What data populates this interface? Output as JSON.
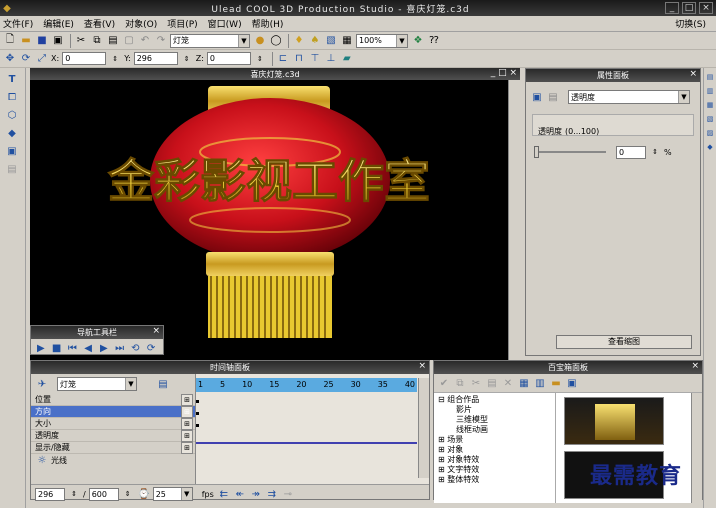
{
  "app": {
    "title": "Ulead COOL 3D Production Studio - 喜庆灯笼.c3d"
  },
  "menu": [
    "文件(F)",
    "编辑(E)",
    "查看(V)",
    "对象(O)",
    "项目(P)",
    "窗口(W)",
    "帮助(H)"
  ],
  "menu_right": "切换(S)",
  "toolbar": {
    "object_combo": "灯笼",
    "zoom_combo": "100%",
    "x_label": "X:",
    "x_value": "0",
    "y_label": "Y:",
    "y_value": "296",
    "z_label": "Z:",
    "z_value": "0"
  },
  "document": {
    "title": "喜庆灯笼.c3d",
    "banner_text": "金彩影视工作室"
  },
  "nav_toolbar": {
    "title": "导航工具栏"
  },
  "properties": {
    "title": "属性面板",
    "combo": "透明度",
    "opacity_label": "透明度",
    "opacity_range": "(0...100)",
    "opacity_value": "0",
    "opacity_unit": "%",
    "view_button": "查看缩图"
  },
  "timeline": {
    "title": "时间轴面板",
    "object_combo": "灯笼",
    "tracks": [
      "位置",
      "方向",
      "大小",
      "透明度",
      "显示/隐藏"
    ],
    "light_label": "光线",
    "ruler": [
      "1",
      "5",
      "10",
      "15",
      "20",
      "25",
      "30",
      "35",
      "40"
    ],
    "frame_value": "296",
    "total_frames": "600",
    "fps_value": "25",
    "fps_label": "fps"
  },
  "library": {
    "title": "百宝箱面板",
    "tree": [
      "组合作品",
      "影片",
      "三维模型",
      "线框动画",
      "场景",
      "对象",
      "对象特效",
      "文字特效",
      "整体特效"
    ]
  },
  "watermark": "最需教育",
  "colors": {
    "title_dark": "#2a2a2a",
    "selection": "#4a70c8",
    "ruler": "#5aaae0",
    "lantern_red": "#c8101a",
    "gold": "#e8d040"
  }
}
